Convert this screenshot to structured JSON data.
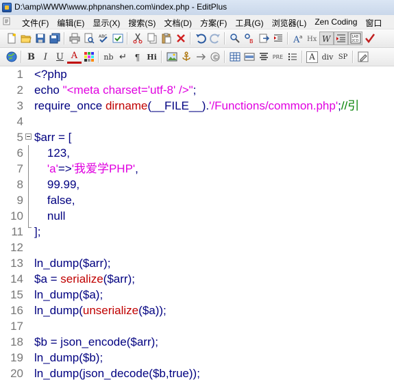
{
  "window": {
    "title": "D:\\amp\\WWW\\www.phpnanshen.com\\index.php - EditPlus"
  },
  "menu": [
    {
      "label": "文件(F)"
    },
    {
      "label": "编辑(E)"
    },
    {
      "label": "显示(X)"
    },
    {
      "label": "搜索(S)"
    },
    {
      "label": "文档(D)"
    },
    {
      "label": "方案(F)"
    },
    {
      "label": "工具(G)"
    },
    {
      "label": "浏览器(L)"
    },
    {
      "label": "Zen Coding"
    },
    {
      "label": "窗口"
    }
  ],
  "toolbar1": {
    "icons": [
      "new-file-icon",
      "open-folder-icon",
      "save-icon",
      "save-all-icon",
      "print-icon",
      "print-preview-icon",
      "spell-check-icon",
      "check-icon",
      "cut-icon",
      "copy-icon",
      "paste-icon",
      "delete-icon",
      "undo-icon",
      "redo-icon",
      "find-icon",
      "replace-icon",
      "goto-icon",
      "indent-icon",
      "font-size-icon",
      "hex-icon",
      "word-wrap-icon",
      "line-numbers-icon",
      "column-icon",
      "checkmark-icon"
    ]
  },
  "toolbar2": {
    "labels": {
      "bold": "B",
      "italic": "I",
      "underline": "U",
      "font_color": "A",
      "nbsp": "nb",
      "newline": "↵",
      "paragraph": "¶",
      "heading": "Hi",
      "pre": "PRE",
      "form": "A",
      "div": "div",
      "span": "SP"
    }
  },
  "editor": {
    "lines": [
      {
        "num": "1",
        "tokens": [
          {
            "t": "<?php",
            "c": "kw"
          }
        ]
      },
      {
        "num": "2",
        "tokens": [
          {
            "t": "echo ",
            "c": "kw"
          },
          {
            "t": "\"<meta charset='utf-8' />\"",
            "c": "str"
          },
          {
            "t": ";",
            "c": "op"
          }
        ]
      },
      {
        "num": "3",
        "tokens": [
          {
            "t": "require_once ",
            "c": "kw"
          },
          {
            "t": "dirname",
            "c": "fn"
          },
          {
            "t": "(__FILE__).",
            "c": "op"
          },
          {
            "t": "'/Functions/common.php'",
            "c": "str"
          },
          {
            "t": ";",
            "c": "op"
          },
          {
            "t": "//引",
            "c": "cm"
          }
        ]
      },
      {
        "num": "4",
        "tokens": []
      },
      {
        "num": "5",
        "tokens": [
          {
            "t": "$arr",
            "c": "var"
          },
          {
            "t": " = [",
            "c": "op"
          }
        ]
      },
      {
        "num": "6",
        "tokens": [
          {
            "t": "    123,",
            "c": "num"
          }
        ]
      },
      {
        "num": "7",
        "tokens": [
          {
            "t": "    ",
            "c": "op"
          },
          {
            "t": "'a'",
            "c": "str"
          },
          {
            "t": "=>",
            "c": "op"
          },
          {
            "t": "'我爱学PHP'",
            "c": "str"
          },
          {
            "t": ",",
            "c": "op"
          }
        ]
      },
      {
        "num": "8",
        "tokens": [
          {
            "t": "    99.99,",
            "c": "num"
          }
        ]
      },
      {
        "num": "9",
        "tokens": [
          {
            "t": "    false,",
            "c": "kw"
          }
        ]
      },
      {
        "num": "10",
        "tokens": [
          {
            "t": "    null",
            "c": "kw"
          }
        ]
      },
      {
        "num": "11",
        "tokens": [
          {
            "t": "];",
            "c": "op"
          }
        ]
      },
      {
        "num": "12",
        "tokens": []
      },
      {
        "num": "13",
        "tokens": [
          {
            "t": "ln_dump(",
            "c": "op"
          },
          {
            "t": "$arr",
            "c": "var"
          },
          {
            "t": ");",
            "c": "op"
          }
        ]
      },
      {
        "num": "14",
        "tokens": [
          {
            "t": "$a",
            "c": "var"
          },
          {
            "t": " = ",
            "c": "op"
          },
          {
            "t": "serialize",
            "c": "fn"
          },
          {
            "t": "(",
            "c": "op"
          },
          {
            "t": "$arr",
            "c": "var"
          },
          {
            "t": ");",
            "c": "op"
          }
        ]
      },
      {
        "num": "15",
        "tokens": [
          {
            "t": "ln_dump(",
            "c": "op"
          },
          {
            "t": "$a",
            "c": "var"
          },
          {
            "t": ");",
            "c": "op"
          }
        ]
      },
      {
        "num": "16",
        "tokens": [
          {
            "t": "ln_dump(",
            "c": "op"
          },
          {
            "t": "unserialize",
            "c": "fn"
          },
          {
            "t": "(",
            "c": "op"
          },
          {
            "t": "$a",
            "c": "var"
          },
          {
            "t": "));",
            "c": "op"
          }
        ]
      },
      {
        "num": "17",
        "tokens": []
      },
      {
        "num": "18",
        "tokens": [
          {
            "t": "$b",
            "c": "var"
          },
          {
            "t": " = json_encode(",
            "c": "op"
          },
          {
            "t": "$arr",
            "c": "var"
          },
          {
            "t": ");",
            "c": "op"
          }
        ]
      },
      {
        "num": "19",
        "tokens": [
          {
            "t": "ln_dump(",
            "c": "op"
          },
          {
            "t": "$b",
            "c": "var"
          },
          {
            "t": ");",
            "c": "op"
          }
        ]
      },
      {
        "num": "20",
        "tokens": [
          {
            "t": "ln_dump(json_decode(",
            "c": "op"
          },
          {
            "t": "$b",
            "c": "var"
          },
          {
            "t": ",true));",
            "c": "op"
          }
        ]
      }
    ]
  }
}
